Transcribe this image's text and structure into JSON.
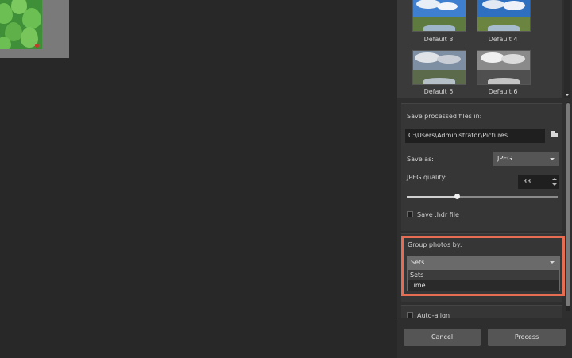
{
  "presets": {
    "items": [
      {
        "label": "Default 3"
      },
      {
        "label": "Default 4"
      },
      {
        "label": "Default 5"
      },
      {
        "label": "Default 6"
      }
    ]
  },
  "save_section": {
    "title": "Save processed files in:",
    "path_value": "C:\\Users\\Administrator\\Pictures",
    "save_as_label": "Save as:",
    "save_as_value": "JPEG",
    "jpeg_quality_label": "JPEG quality:",
    "jpeg_quality_value": "33",
    "jpeg_quality_fraction": 0.33,
    "save_hdr_label": "Save .hdr file",
    "save_hdr_checked": false
  },
  "group_section": {
    "title": "Group photos by:",
    "selected": "Sets",
    "options": [
      "Sets",
      "Time"
    ]
  },
  "next_section": {
    "auto_align_label": "Auto-align"
  },
  "buttons": {
    "cancel": "Cancel",
    "process": "Process"
  },
  "colors": {
    "highlight": "#e66c52",
    "panel_bg": "#2f2f2f",
    "canvas_bg": "#282828"
  }
}
